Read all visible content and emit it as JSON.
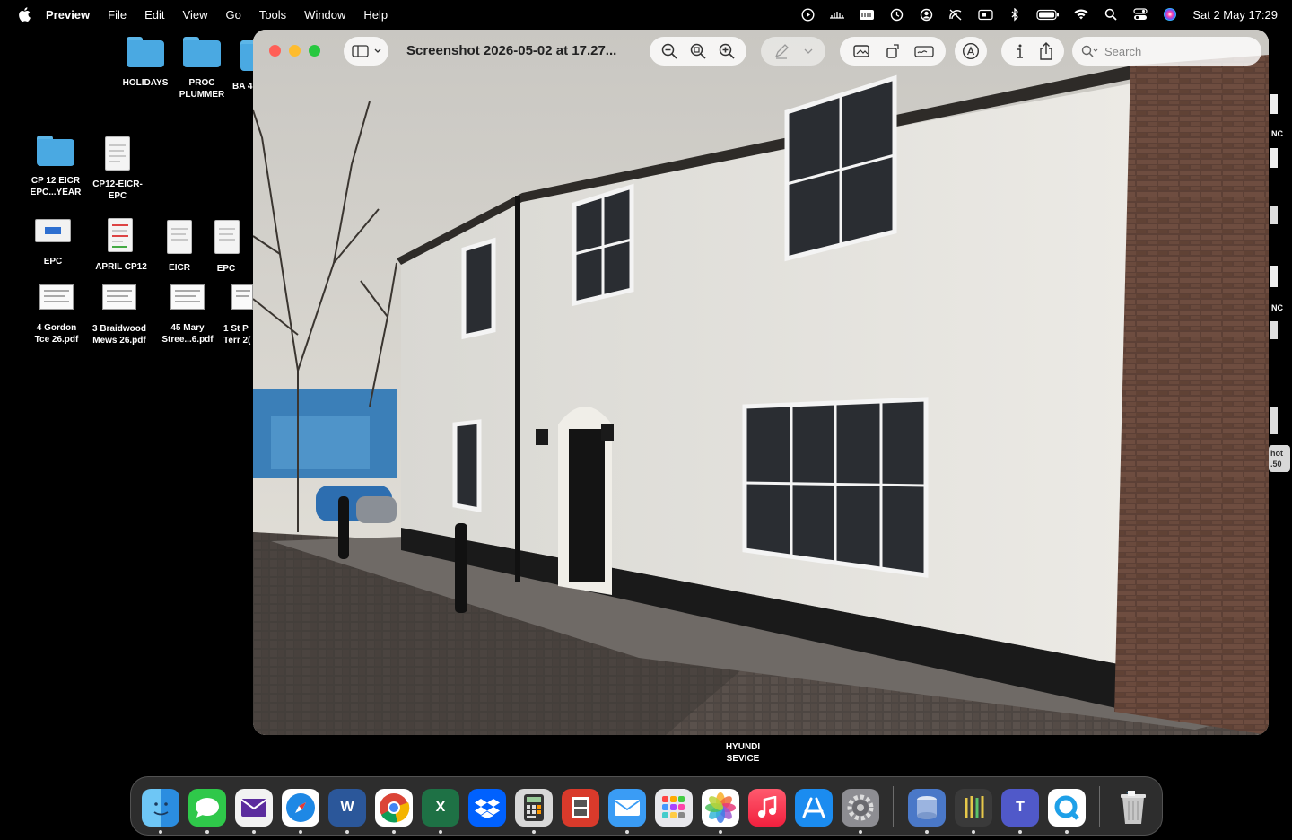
{
  "menubar": {
    "app_name": "Preview",
    "items": [
      "File",
      "Edit",
      "View",
      "Go",
      "Tools",
      "Window",
      "Help"
    ],
    "clock": "Sat 2 May  17:29",
    "status_icons": [
      "play-icon",
      "audio-meter-icon",
      "keyboard-icon",
      "time-machine-icon",
      "user-icon",
      "no-signal-icon",
      "display-icon",
      "bluetooth-icon",
      "battery-icon",
      "wifi-icon",
      "search-icon",
      "control-center-icon",
      "siri-icon"
    ]
  },
  "desktop": {
    "items": [
      {
        "label1": "HOLIDAYS",
        "label2": "",
        "kind": "folder"
      },
      {
        "label1": "PROC",
        "label2": "PLUMMER",
        "kind": "folder"
      },
      {
        "label1": "BA 4",
        "label2": "",
        "kind": "folder"
      },
      {
        "label1": "CP 12   EICR",
        "label2": "EPC...YEAR",
        "kind": "folder"
      },
      {
        "label1": "CP12-EICR-",
        "label2": "EPC",
        "kind": "document"
      },
      {
        "label1": "EPC",
        "label2": "",
        "kind": "app-window"
      },
      {
        "label1": "APRIL CP12",
        "label2": "",
        "kind": "document"
      },
      {
        "label1": "EICR",
        "label2": "",
        "kind": "document"
      },
      {
        "label1": "EPC",
        "label2": "",
        "kind": "document"
      },
      {
        "label1": "4 Gordon",
        "label2": "Tce 26.pdf",
        "kind": "pdf"
      },
      {
        "label1": "3 Braidwood",
        "label2": "Mews 26.pdf",
        "kind": "pdf"
      },
      {
        "label1": "45 Mary",
        "label2": "Stree...6.pdf",
        "kind": "pdf"
      },
      {
        "label1": "1 St P",
        "label2": "Terr 2(",
        "kind": "pdf"
      }
    ],
    "right_fragments": [
      "NC",
      "NC",
      "hot",
      ".50"
    ],
    "tooltip_line1": "HYUNDI",
    "tooltip_line2": "SEVICE"
  },
  "window": {
    "title": "Screenshot 2026-05-02 at 17.27...",
    "search_placeholder": "Search",
    "toolbar_icons": [
      "sidebar-toggle-icon",
      "zoom-out-icon",
      "zoom-fit-icon",
      "zoom-in-icon",
      "markup-pen-icon",
      "chevron-down-icon",
      "crop-icon",
      "rotate-icon",
      "sign-icon",
      "annotate-icon",
      "info-icon",
      "share-icon"
    ]
  },
  "dock": {
    "apps": [
      "Finder",
      "Messages",
      "Mail Alt",
      "Safari",
      "Word",
      "Chrome",
      "Excel",
      "Dropbox",
      "Calculator",
      "Photo Booth",
      "Mail",
      "Launchpad",
      "Photos",
      "Music",
      "App Store",
      "System Settings",
      "Time Machine",
      "Keychain",
      "Teams",
      "QuickTime",
      "Trash"
    ],
    "running": [
      true,
      true,
      true,
      true,
      true,
      true,
      true,
      false,
      true,
      false,
      true,
      false,
      true,
      false,
      false,
      true,
      true,
      true,
      true,
      true,
      false
    ]
  },
  "colors": {
    "close": "#ff5f57",
    "minimize": "#febc2e",
    "zoom": "#28c840",
    "folder": "#4aa9e2"
  }
}
